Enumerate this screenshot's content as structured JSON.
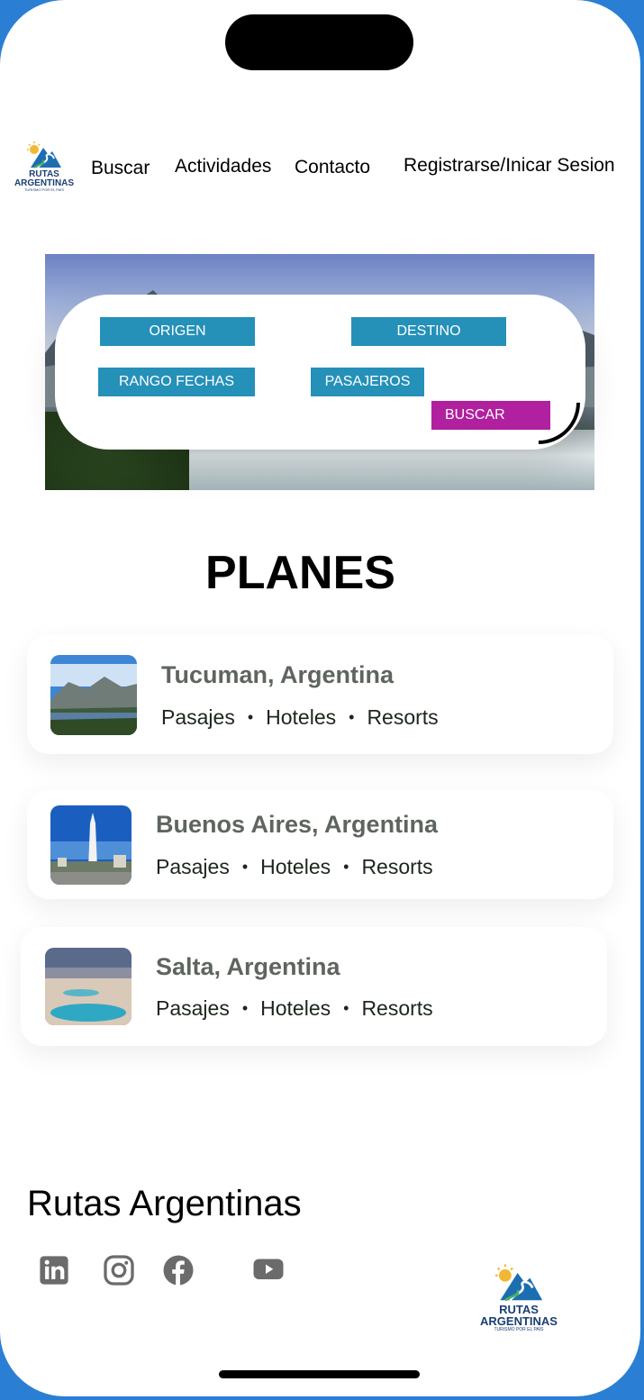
{
  "brand": {
    "name": "RUTAS",
    "name2": "ARGENTINAS",
    "tagline": "TURISMO POR EL PAÍS"
  },
  "nav": {
    "buscar": "Buscar",
    "actividades": "Actividades",
    "contacto": "Contacto",
    "auth": "Registrarse/Inicar Sesion"
  },
  "search": {
    "origen": "ORIGEN",
    "destino": "DESTINO",
    "rango_fechas": "RANGO FECHAS",
    "pasajeros": "PASAJEROS",
    "buscar": "BUSCAR"
  },
  "plans": {
    "title": "PLANES",
    "items": [
      {
        "title": "Tucuman, Argentina",
        "tags": [
          "Pasajes",
          "Hoteles",
          "Resorts"
        ]
      },
      {
        "title": "Buenos Aires, Argentina",
        "tags": [
          "Pasajes",
          "Hoteles",
          "Resorts"
        ]
      },
      {
        "title": "Salta, Argentina",
        "tags": [
          "Pasajes",
          "Hoteles",
          "Resorts"
        ]
      }
    ]
  },
  "footer": {
    "title": "Rutas Argentinas",
    "social": [
      "linkedin-icon",
      "instagram-icon",
      "facebook-icon",
      "youtube-icon"
    ]
  },
  "colors": {
    "field": "#2590b8",
    "buscar": "#b0209f",
    "brand": "#1b3f73",
    "accent_frame": "#2a7fd4"
  }
}
